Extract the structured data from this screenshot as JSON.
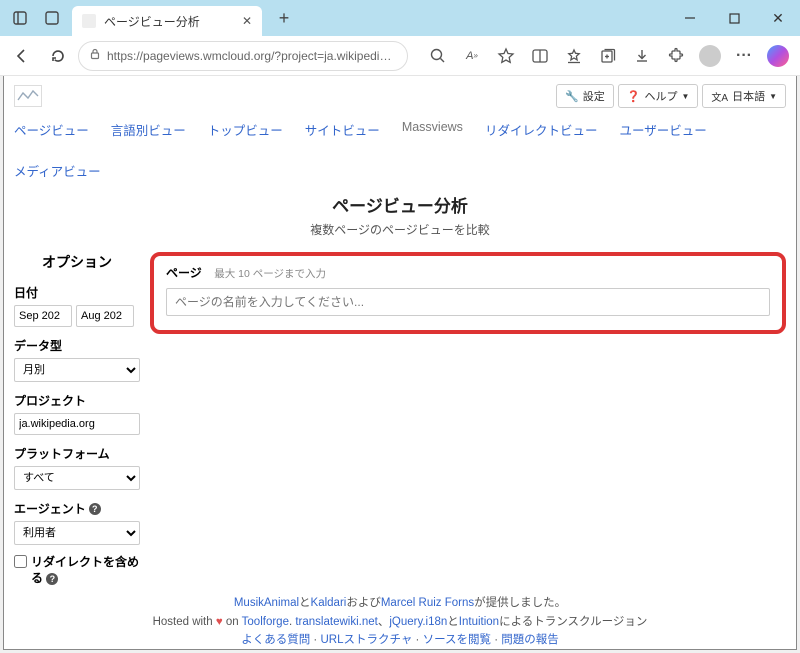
{
  "browser": {
    "tab_title": "ページビュー分析",
    "url": "https://pageviews.wmcloud.org/?project=ja.wikipedia.or..."
  },
  "topbar": {
    "settings": "設定",
    "help": "ヘルプ",
    "lang": "日本語"
  },
  "nav": {
    "pageviews": "ページビュー",
    "langviews": "言語別ビュー",
    "topviews": "トップビュー",
    "siteviews": "サイトビュー",
    "massviews": "Massviews",
    "redirectviews": "リダイレクトビュー",
    "userviews": "ユーザービュー",
    "mediaviews": "メディアビュー"
  },
  "heading": {
    "title": "ページビュー分析",
    "subtitle": "複数ページのページビューを比較"
  },
  "sidebar": {
    "options": "オプション",
    "date_label": "日付",
    "date_from": "Sep 202",
    "date_to": "Aug 202",
    "datatype_label": "データ型",
    "datatype_value": "月別",
    "project_label": "プロジェクト",
    "project_value": "ja.wikipedia.org",
    "platform_label": "プラットフォーム",
    "platform_value": "すべて",
    "agent_label": "エージェント",
    "agent_value": "利用者",
    "redirects_label": "リダイレクトを含める"
  },
  "pages_box": {
    "label": "ページ",
    "hint": "最大 10 ページまで入力",
    "placeholder": "ページの名前を入力してください..."
  },
  "footer": {
    "link_musik": "MusikAnimal",
    "t_and": "と",
    "link_kaldari": "Kaldari",
    "t_oyobi": "および",
    "link_marcel": "Marcel Ruiz Forns",
    "t_provided": "が提供しました。",
    "t_hosted": "Hosted with ",
    "t_on": " on ",
    "link_toolforge": "Toolforge",
    "t_dot": ". ",
    "link_trans": "translatewiki.net",
    "t_comma": "、",
    "link_jquery": "jQuery.i18n",
    "t_to": "と",
    "link_intuition": "Intuition",
    "t_niyoru": "によるトランスクルージョン",
    "link_faq": "よくある質問",
    "sep": " · ",
    "link_url": "URLストラクチャ",
    "link_source": "ソースを閲覧",
    "link_report": "問題の報告"
  }
}
